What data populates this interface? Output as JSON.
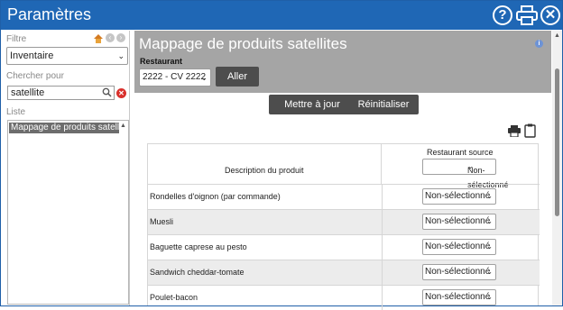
{
  "window": {
    "title": "Paramètres"
  },
  "titlebar_icons": [
    "help-icon",
    "print-icon",
    "close-icon"
  ],
  "sidebar": {
    "filter_label": "Filtre",
    "filter_value": "Inventaire",
    "search_label": "Chercher pour",
    "search_value": "satellite",
    "list_label": "Liste",
    "list_items": [
      "Mappage de produits satellites"
    ]
  },
  "main": {
    "title": "Mappage de produits satellites",
    "restaurant_label": "Restaurant",
    "restaurant_value": "2222 - CV 2222",
    "go_button": "Aller",
    "update_button": "Mettre à jour",
    "reset_button": "Réinitialiser",
    "table": {
      "col_description": "Description du produit",
      "col_source": "Restaurant source",
      "header_select": "Non-sélectionné",
      "rows": [
        {
          "description": "Rondelles d'oignon (par commande)",
          "source": "Non-sélectionné"
        },
        {
          "description": "Muesli",
          "source": "Non-sélectionné"
        },
        {
          "description": "Baguette caprese au pesto",
          "source": "Non-sélectionné"
        },
        {
          "description": "Sandwich cheddar-tomate",
          "source": "Non-sélectionné"
        },
        {
          "description": "Poulet-bacon",
          "source": "Non-sélectionné"
        }
      ]
    }
  },
  "colors": {
    "titlebar": "#1f67b5",
    "header": "#a5a5a5",
    "dark_button": "#4d4d4d",
    "error": "#d9302c"
  }
}
